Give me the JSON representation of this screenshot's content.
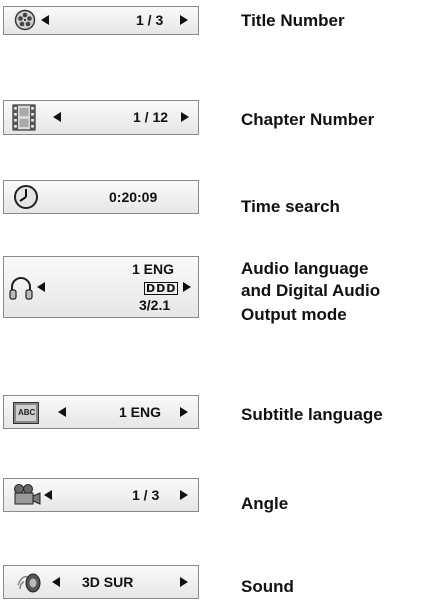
{
  "rows": [
    {
      "icon": "film-reel-icon",
      "value": "1 / 3",
      "label": "Title Number",
      "has_left_arrow": true,
      "has_right_arrow": true
    },
    {
      "icon": "film-strip-icon",
      "value": "1 / 12",
      "label": "Chapter Number",
      "has_left_arrow": true,
      "has_right_arrow": true
    },
    {
      "icon": "clock-icon",
      "value": "0:20:09",
      "label": "Time search",
      "has_left_arrow": false,
      "has_right_arrow": false
    },
    {
      "icon": "headphones-icon",
      "value_line1": "1 ENG",
      "value_line2": "DDD",
      "value_line3": "3/2.1",
      "label_line1": "Audio language",
      "label_line2": "and Digital Audio",
      "label_line3": "Output mode",
      "has_left_arrow": true,
      "has_right_arrow": true
    },
    {
      "icon": "subtitle-abc-icon",
      "icon_text": "ABC",
      "value": "1 ENG",
      "label": "Subtitle language",
      "has_left_arrow": true,
      "has_right_arrow": true
    },
    {
      "icon": "camera-icon",
      "value": "1 / 3",
      "label": "Angle",
      "has_left_arrow": true,
      "has_right_arrow": true
    },
    {
      "icon": "speaker-icon",
      "value": "3D SUR",
      "label": "Sound",
      "has_left_arrow": true,
      "has_right_arrow": true
    }
  ]
}
